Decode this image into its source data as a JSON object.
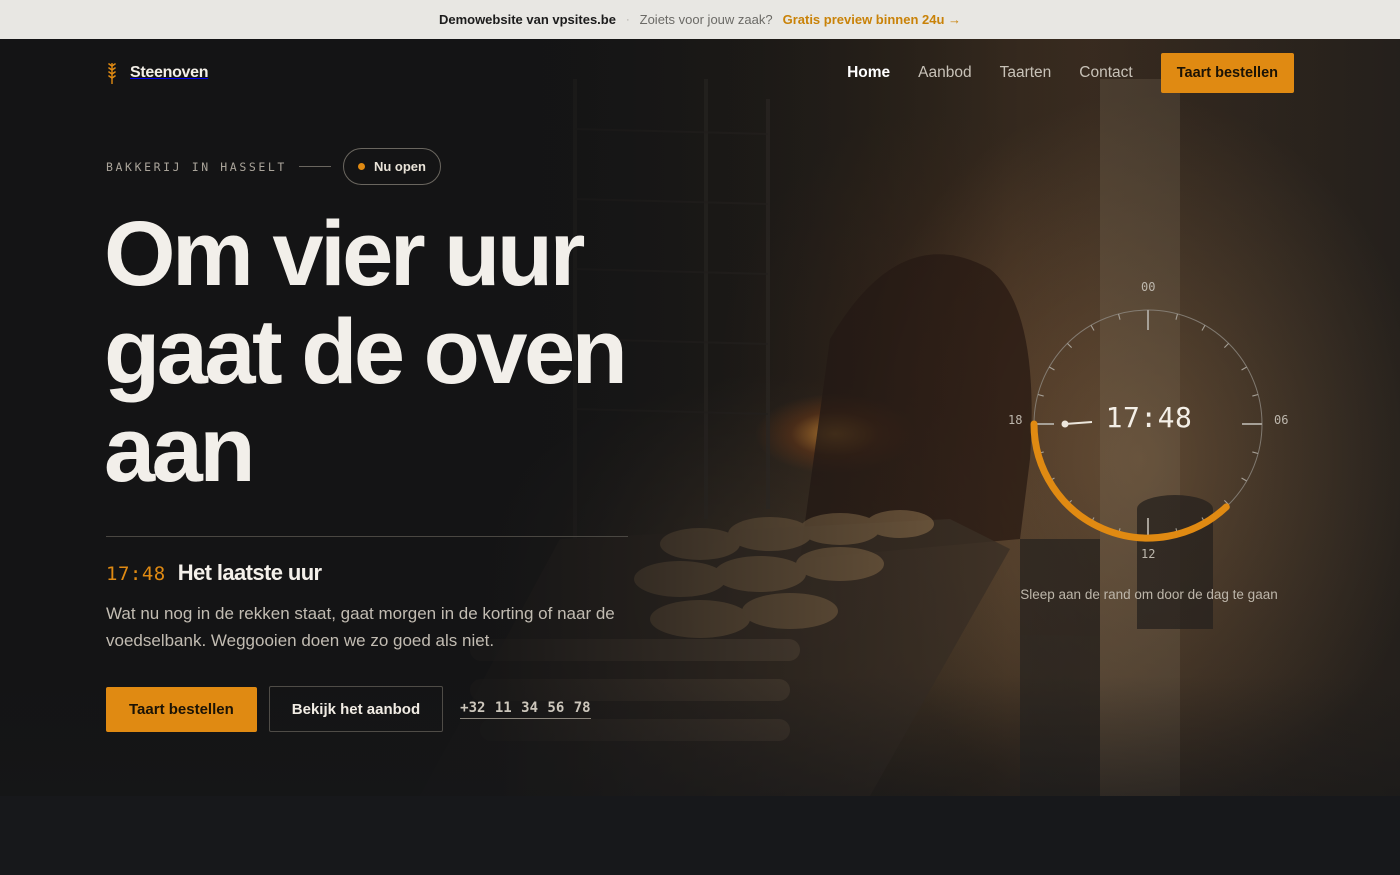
{
  "topbar": {
    "site": "Demowebsite van vpsites.be",
    "separator": "·",
    "question": "Zoiets voor jouw zaak?",
    "cta": "Gratis preview binnen 24u →"
  },
  "nav": {
    "brand": "Steenoven",
    "brand_icon": "wheat-icon",
    "links": [
      "Home",
      "Aanbod",
      "Taarten",
      "Contact"
    ],
    "active": "Home",
    "cta": "Taart bestellen"
  },
  "hero": {
    "eyebrow": "BAKKERIJ IN HASSELT",
    "status_pill": "Nu open",
    "headline": [
      "Om vier uur",
      "gaat de oven",
      "aan"
    ],
    "status_time": "17:48",
    "status_title": "Het laatste uur",
    "description": "Wat nu nog in de rekken staat, gaat morgen in de korting of naar de voedselbank. Weggooien doen we zo goed als niet.",
    "primary_button": "Taart bestellen",
    "secondary_button": "Bekijk het aanbod",
    "phone": "+32 11 34 56 78"
  },
  "clock": {
    "time": "17:48",
    "labels": {
      "top": "00",
      "right": "06",
      "bottom": "12",
      "left": "18"
    },
    "hint": "Sleep aan de rand om door de dag te gaan",
    "progress_fraction": 0.741
  },
  "colors": {
    "accent": "#e08a12",
    "background": "#161719",
    "topbar": "#e8e7e3",
    "text": "#f2efea"
  }
}
